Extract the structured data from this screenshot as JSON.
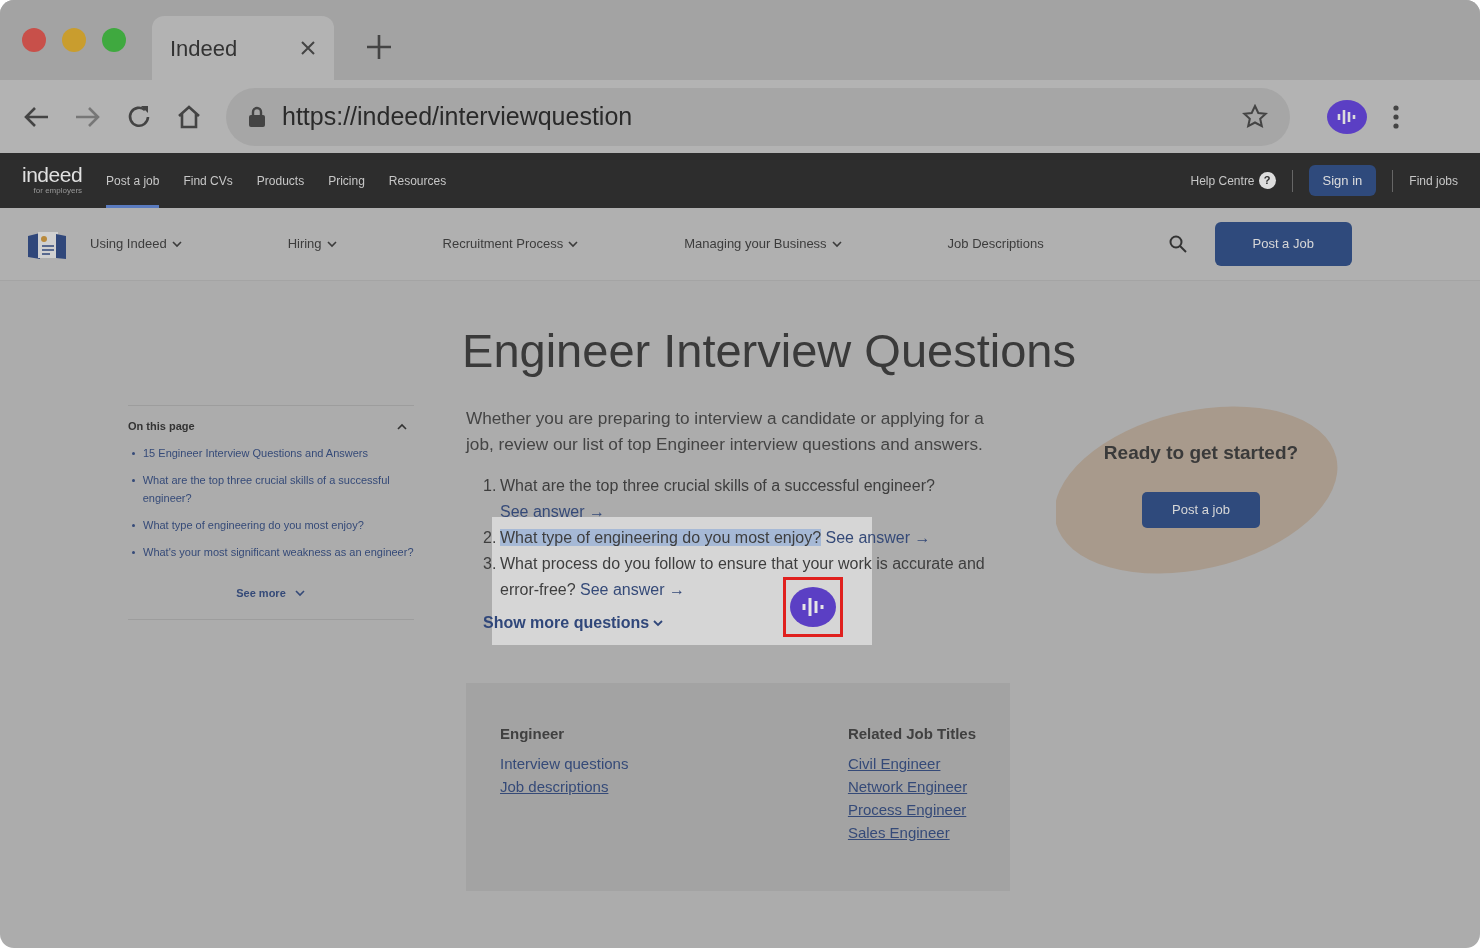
{
  "browser": {
    "tab_title": "Indeed",
    "url": "https://indeed/interviewquestion"
  },
  "site_header": {
    "logo": "indeed",
    "logo_sub": "for employers",
    "links": [
      {
        "label": "Post a job",
        "selected": true
      },
      {
        "label": "Find CVs",
        "selected": false
      },
      {
        "label": "Products",
        "selected": false
      },
      {
        "label": "Pricing",
        "selected": false
      },
      {
        "label": "Resources",
        "selected": false
      }
    ],
    "help": "Help Centre",
    "help_mark": "?",
    "sign_in": "Sign in",
    "find_jobs": "Find jobs"
  },
  "subnav": {
    "items": [
      {
        "label": "Using Indeed",
        "has_dropdown": true
      },
      {
        "label": "Hiring",
        "has_dropdown": true
      },
      {
        "label": "Recruitment Process",
        "has_dropdown": true
      },
      {
        "label": "Managing your Business",
        "has_dropdown": true
      },
      {
        "label": "Job Descriptions",
        "has_dropdown": false
      }
    ],
    "button": "Post a Job"
  },
  "title": "Engineer Interview Questions",
  "sidebar": {
    "heading": "On this page",
    "expanded": true,
    "links": [
      "15 Engineer Interview Questions and Answers",
      "What are the top three crucial skills of a successful engineer?",
      "What type of engineering do you most enjoy?",
      "What's your most significant weakness as an engineer?"
    ],
    "see_more": "See more"
  },
  "intro": "Whether you are preparing to interview a candidate or applying for a job, review our list of top Engineer interview questions and answers.",
  "questions": [
    {
      "number": "1.",
      "text": "What are the top three crucial skills of a successful engineer?",
      "link": "See answer →",
      "text_selected": false,
      "spotlight": false
    },
    {
      "number": "2.",
      "text": "What type of engineering do you most enjoy?",
      "link": "See answer →",
      "text_selected": true,
      "spotlight": true
    },
    {
      "number": "3.",
      "text": "What process do you follow to ensure that your work is accurate and error-free?",
      "link": "See answer →",
      "text_selected": false,
      "spotlight": true
    }
  ],
  "show_more": {
    "label": "Show more questions",
    "spotlight": true
  },
  "assistant_button": {
    "outlined": true
  },
  "related": [
    {
      "heading": "Engineer",
      "links": [
        {
          "label": "Interview questions",
          "underlined": false
        },
        {
          "label": "Job descriptions",
          "underlined": true
        }
      ]
    },
    {
      "heading": "Related Job Titles",
      "links": [
        {
          "label": "Civil Engineer",
          "underlined": true
        },
        {
          "label": "Network Engineer",
          "underlined": true
        },
        {
          "label": "Process Engineer",
          "underlined": true
        },
        {
          "label": "Sales Engineer",
          "underlined": true
        }
      ]
    }
  ],
  "cta": {
    "heading": "Ready to get started?",
    "button": "Post a job"
  }
}
